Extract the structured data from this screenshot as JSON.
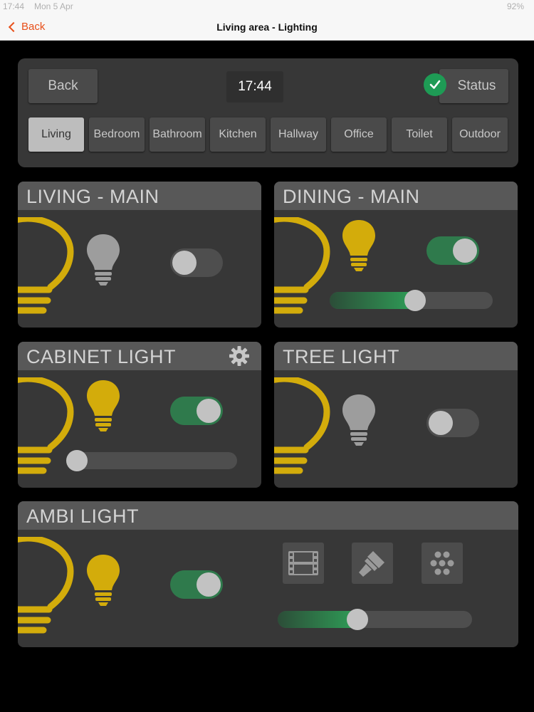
{
  "status_bar": {
    "time": "17:44",
    "date": "Mon 5 Apr",
    "battery": "92%"
  },
  "nav": {
    "back_label": "Back",
    "title": "Living area - Lighting"
  },
  "top_panel": {
    "back_label": "Back",
    "clock": "17:44",
    "status_label": "Status",
    "tabs": [
      "Living",
      "Bedroom",
      "Bathroom",
      "Kitchen",
      "Hallway",
      "Office",
      "Toilet",
      "Outdoor"
    ],
    "active_tab": "Living"
  },
  "cards": {
    "living_main": {
      "title": "LIVING - MAIN",
      "state": "off"
    },
    "dining_main": {
      "title": "DINING - MAIN",
      "state": "on",
      "dim_level": 0.53
    },
    "cabinet_light": {
      "title": "CABINET LIGHT",
      "state": "on",
      "dim_level": 0.0
    },
    "tree_light": {
      "title": "TREE LIGHT",
      "state": "off"
    },
    "ambi_light": {
      "title": "AMBI LIGHT",
      "state": "on",
      "dim_level": 0.4,
      "modes": [
        "film-icon",
        "paint-brush-icon",
        "dots-pattern-icon"
      ]
    }
  },
  "colors": {
    "bulb_on": "#d3ac0b",
    "bulb_off": "#9d9d9d",
    "toggle_on": "#2f7a4c",
    "accent": "#e8501a",
    "check": "#1e9b55"
  }
}
